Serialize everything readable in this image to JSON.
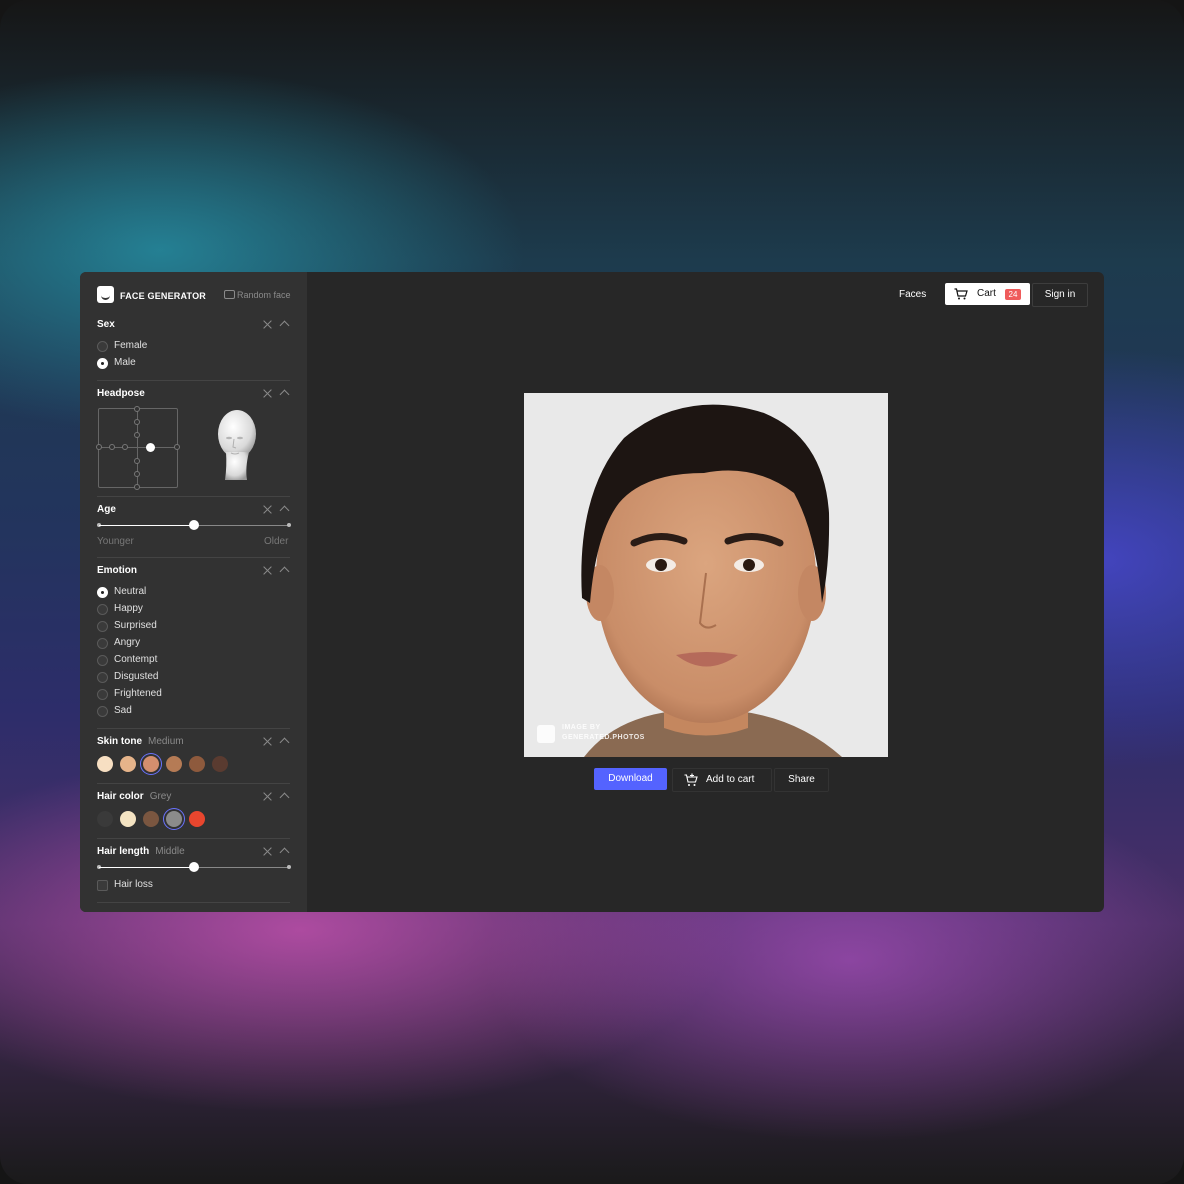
{
  "brand": {
    "name": "FACE GENERATOR",
    "random_label": "Random face"
  },
  "sidebar": {
    "sex": {
      "title": "Sex",
      "options": [
        "Female",
        "Male"
      ],
      "selected": "Male"
    },
    "headpose": {
      "title": "Headpose"
    },
    "age": {
      "title": "Age",
      "min_label": "Younger",
      "max_label": "Older",
      "value": 0.5
    },
    "emotion": {
      "title": "Emotion",
      "options": [
        "Neutral",
        "Happy",
        "Surprised",
        "Angry",
        "Contempt",
        "Disgusted",
        "Frightened",
        "Sad"
      ],
      "selected": "Neutral"
    },
    "skin_tone": {
      "title": "Skin tone",
      "selected_label": "Medium",
      "colors": [
        "#f7dfc2",
        "#e6b48a",
        "#d48f6e",
        "#b57b55",
        "#8e5a3d",
        "#5a3b30"
      ],
      "selected_index": 2
    },
    "hair_color": {
      "title": "Hair color",
      "selected_label": "Grey",
      "colors": [
        "#3a3a3a",
        "#f4e3c2",
        "#7a5640",
        "#8b8b8b",
        "#e8462e"
      ],
      "selected_index": 3
    },
    "hair_length": {
      "title": "Hair length",
      "selected_label": "Middle",
      "value": 0.5,
      "hair_loss_label": "Hair loss"
    }
  },
  "topnav": {
    "faces": "Faces",
    "cart": "Cart",
    "cart_count": "24",
    "sign_in": "Sign in"
  },
  "photo": {
    "watermark_line1": "IMAGE BY",
    "watermark_line2": "GENERATED.PHOTOS"
  },
  "actions": {
    "download": "Download",
    "add_to_cart": "Add to cart",
    "share": "Share"
  },
  "colors": {
    "accent": "#5463ff",
    "badge": "#ef5b5b",
    "panel": "#323232",
    "canvas": "#272727"
  }
}
